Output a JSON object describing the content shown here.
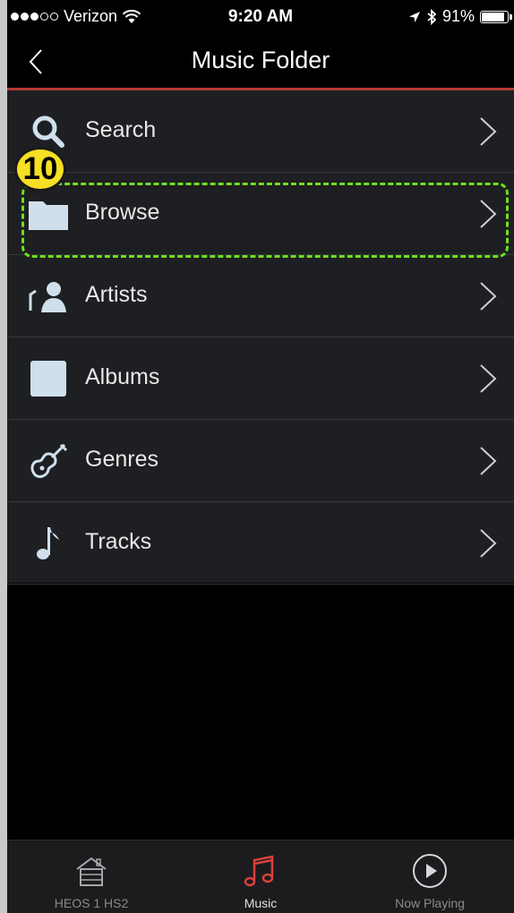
{
  "status_bar": {
    "carrier": "Verizon",
    "time": "9:20 AM",
    "battery_percent": "91%",
    "battery_level": 0.91
  },
  "nav": {
    "title": "Music Folder",
    "back_icon": "chevron-left-icon"
  },
  "annotation": {
    "step_number": "10",
    "highlight_color": "#6ee11c",
    "badge_color": "#f6df24"
  },
  "menu": {
    "items": [
      {
        "label": "Search",
        "icon": "search-icon"
      },
      {
        "label": "Browse",
        "icon": "folder-icon"
      },
      {
        "label": "Artists",
        "icon": "artist-icon"
      },
      {
        "label": "Albums",
        "icon": "album-icon"
      },
      {
        "label": "Genres",
        "icon": "guitar-icon"
      },
      {
        "label": "Tracks",
        "icon": "music-note-icon"
      }
    ]
  },
  "tabbar": {
    "tabs": [
      {
        "label": "HEOS 1 HS2",
        "icon": "home-icon",
        "active": false
      },
      {
        "label": "Music",
        "icon": "music-notes-icon",
        "active": true
      },
      {
        "label": "Now Playing",
        "icon": "play-circle-icon",
        "active": false
      }
    ]
  },
  "colors": {
    "accent": "#d9413a",
    "nav_divider": "#b33a33",
    "list_background": "#1e1f22",
    "icon_fill": "#cfe0ec"
  }
}
